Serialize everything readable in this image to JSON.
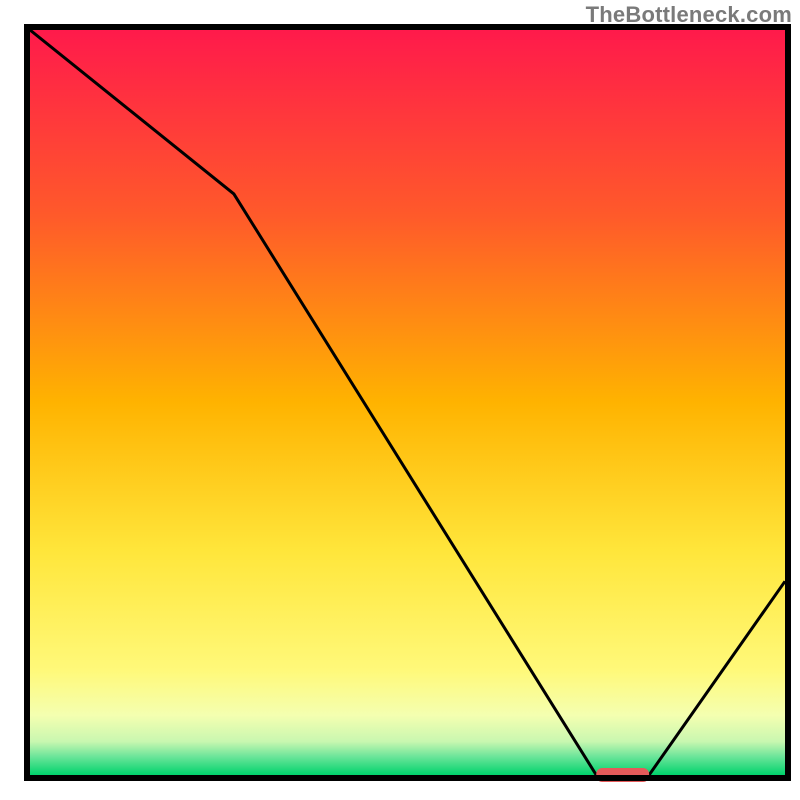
{
  "watermark": "TheBottleneck.com",
  "chart_data": {
    "type": "line",
    "title": "",
    "xlabel": "",
    "ylabel": "",
    "xlim": [
      0,
      100
    ],
    "ylim": [
      0,
      100
    ],
    "x": [
      0,
      27,
      75,
      82,
      100
    ],
    "values": [
      100,
      78,
      0,
      0,
      26
    ],
    "marker": {
      "x_range": [
        75,
        82
      ],
      "y": 0
    },
    "gradient_stops": [
      {
        "pos": 0.0,
        "color": "#ff1a4b"
      },
      {
        "pos": 0.25,
        "color": "#ff5a2a"
      },
      {
        "pos": 0.5,
        "color": "#ffb300"
      },
      {
        "pos": 0.7,
        "color": "#ffe63b"
      },
      {
        "pos": 0.86,
        "color": "#fff97a"
      },
      {
        "pos": 0.92,
        "color": "#f4ffb0"
      },
      {
        "pos": 0.955,
        "color": "#c9f7b0"
      },
      {
        "pos": 0.975,
        "color": "#6de59a"
      },
      {
        "pos": 1.0,
        "color": "#00d36c"
      }
    ]
  },
  "plot_geometry": {
    "inner_left": 30,
    "inner_top": 30,
    "inner_width": 755,
    "inner_height": 745,
    "border_width": 6
  }
}
